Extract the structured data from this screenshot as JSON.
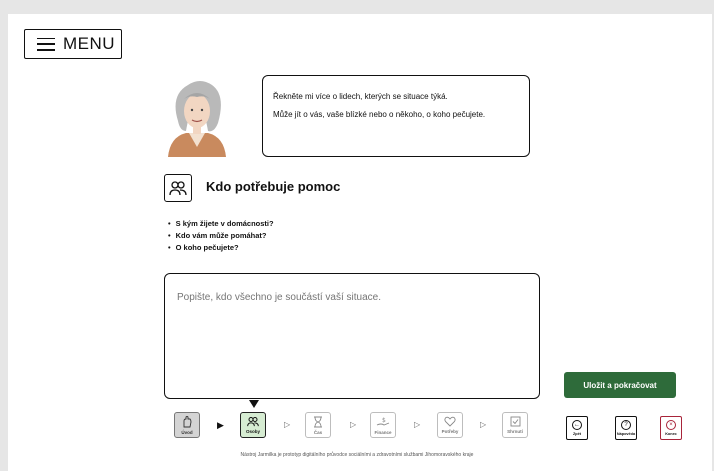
{
  "menu": {
    "label": "MENU",
    "icon": "hamburger-icon"
  },
  "assistant": {
    "icon": "woman-portrait",
    "line1": "Řekněte mi více o lidech, kterých se situace týká.",
    "line2": "Může jít o vás, vaše blízké nebo o někoho, o koho pečujete."
  },
  "section": {
    "icon": "people-icon",
    "title": "Kdo potřebuje pomoc",
    "questions": [
      "S kým žijete v domácnosti?",
      "Kdo vám může pomáhat?",
      "O koho pečujete?"
    ]
  },
  "input": {
    "placeholder": "Popište, kdo všechno je součástí vaší situace.",
    "value": ""
  },
  "save_button": {
    "label": "Uložit a pokračovat",
    "color": "#2e6b3a"
  },
  "steps": [
    {
      "label": "Úvod",
      "icon": "hand-icon",
      "state": "done"
    },
    {
      "label": "Osoby",
      "icon": "people-icon",
      "state": "current"
    },
    {
      "label": "Čas",
      "icon": "hourglass-icon",
      "state": "upcoming"
    },
    {
      "label": "Finance",
      "icon": "money-hand-icon",
      "state": "upcoming"
    },
    {
      "label": "Potřeby",
      "icon": "heart-icon",
      "state": "upcoming"
    },
    {
      "label": "Shrnutí",
      "icon": "checklist-icon",
      "state": "upcoming"
    }
  ],
  "nav": {
    "back": {
      "label": "Zpět",
      "icon": "back-arrow-icon"
    },
    "help": {
      "label": "Nápověda",
      "icon": "question-icon"
    },
    "end": {
      "label": "Konec",
      "icon": "close-icon",
      "color": "#a8243a"
    }
  },
  "footer": "Nástroj Jarmilka je prototyp digitálního průvodce sociálními a zdravotními službami Jihomoravského kraje"
}
